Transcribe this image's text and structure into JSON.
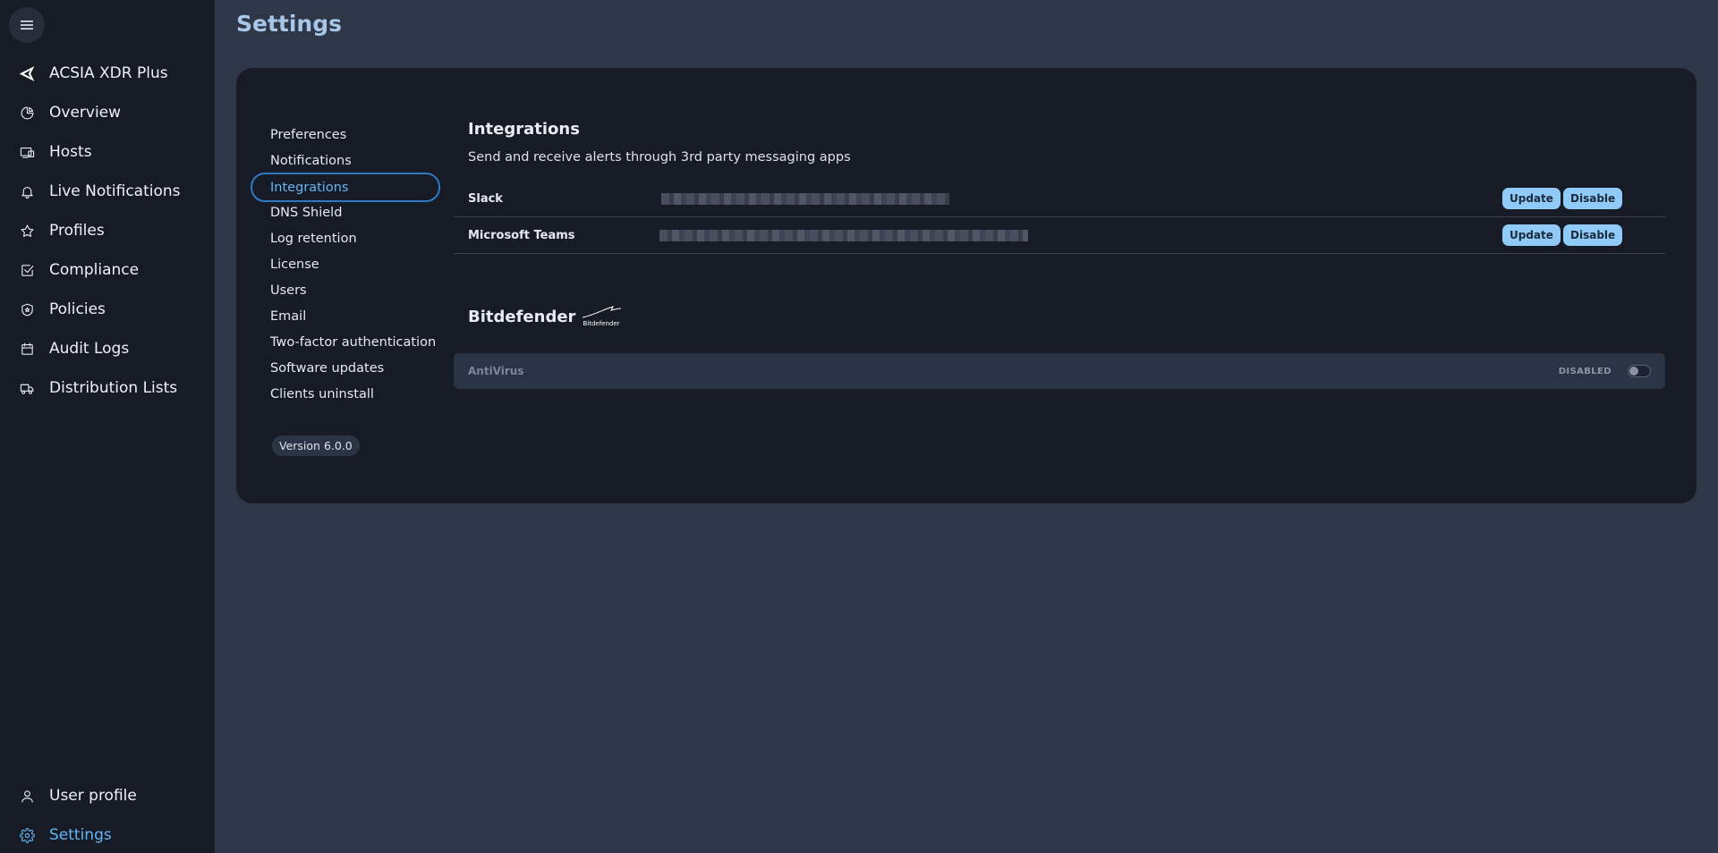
{
  "sidebar": {
    "items": [
      {
        "label": "ACSIA XDR Plus",
        "icon": "acsia-logo-icon"
      },
      {
        "label": "Overview",
        "icon": "pie-chart-icon"
      },
      {
        "label": "Hosts",
        "icon": "devices-icon"
      },
      {
        "label": "Live Notifications",
        "icon": "bell-icon"
      },
      {
        "label": "Profiles",
        "icon": "star-icon"
      },
      {
        "label": "Compliance",
        "icon": "checkbox-icon"
      },
      {
        "label": "Policies",
        "icon": "shield-icon"
      },
      {
        "label": "Audit Logs",
        "icon": "calendar-icon"
      },
      {
        "label": "Distribution Lists",
        "icon": "truck-icon"
      }
    ],
    "bottom_items": [
      {
        "label": "User profile",
        "icon": "user-icon"
      },
      {
        "label": "Settings",
        "icon": "gear-icon"
      }
    ]
  },
  "page": {
    "title": "Settings"
  },
  "settings_menu": {
    "items": [
      "Preferences",
      "Notifications",
      "Integrations",
      "DNS Shield",
      "Log retention",
      "License",
      "Users",
      "Email",
      "Two-factor authentication",
      "Software updates",
      "Clients uninstall"
    ],
    "active": "Integrations",
    "version": "Version 6.0.0"
  },
  "integrations": {
    "title": "Integrations",
    "description": "Send and receive alerts through 3rd party messaging apps",
    "rows": [
      {
        "name": "Slack",
        "update_label": "Update",
        "disable_label": "Disable"
      },
      {
        "name": "Microsoft Teams",
        "update_label": "Update",
        "disable_label": "Disable"
      }
    ]
  },
  "bitdefender": {
    "title": "Bitdefender",
    "logo_text": "Bitdefender",
    "antivirus": {
      "label": "AntiVirus",
      "status": "DISABLED",
      "enabled": false
    }
  },
  "colors": {
    "accent": "#64b5f6",
    "button": "#90caf9",
    "sidebar_bg": "#171b26",
    "page_bg": "#2e3748"
  }
}
